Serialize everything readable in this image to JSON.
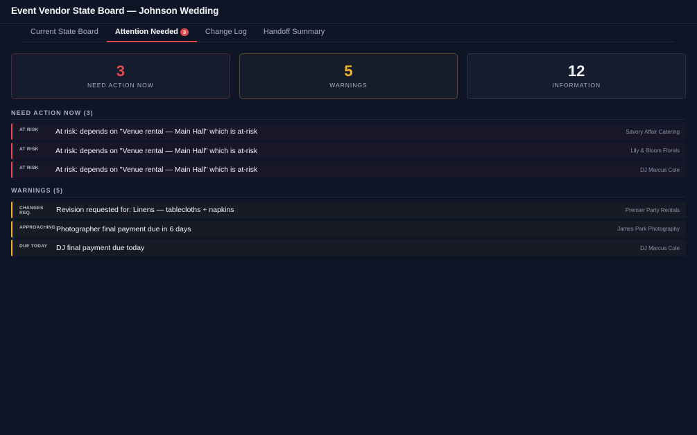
{
  "header": {
    "title": "Event Vendor State Board — Johnson Wedding"
  },
  "tabs": [
    {
      "label": "Current State Board",
      "active": false
    },
    {
      "label": "Attention Needed",
      "active": true,
      "badge": "3"
    },
    {
      "label": "Change Log",
      "active": false
    },
    {
      "label": "Handoff Summary",
      "active": false
    }
  ],
  "stats": [
    {
      "value": "3",
      "label": "NEED ACTION NOW",
      "color": "#e5484d"
    },
    {
      "value": "5",
      "label": "WARNINGS",
      "color": "#f0b429"
    },
    {
      "value": "12",
      "label": "INFORMATION",
      "color": "#f2f4f8"
    }
  ],
  "need_action": {
    "heading": "NEED ACTION NOW (3)",
    "items": [
      {
        "tag": "AT RISK",
        "text": "At risk: depends on \"Venue rental — Main Hall\" which is at-risk",
        "vendor": "Savory Affair Catering"
      },
      {
        "tag": "AT RISK",
        "text": "At risk: depends on \"Venue rental — Main Hall\" which is at-risk",
        "vendor": "Lily & Bloom Florals"
      },
      {
        "tag": "AT RISK",
        "text": "At risk: depends on \"Venue rental — Main Hall\" which is at-risk",
        "vendor": "DJ Marcus Cole"
      }
    ]
  },
  "warnings": {
    "heading": "WARNINGS (5)",
    "items": [
      {
        "tag": "CHANGES REQ.",
        "text": "Revision requested for: Linens — tablecloths + napkins",
        "vendor": "Premier Party Rentals"
      },
      {
        "tag": "APPROACHING",
        "text": "Photographer final payment due in 6 days",
        "vendor": "James Park Photography"
      },
      {
        "tag": "DUE TODAY",
        "text": "DJ final payment due today",
        "vendor": "DJ Marcus Cole"
      }
    ]
  },
  "colors": {
    "danger": "#e5484d",
    "warning": "#f0b429",
    "background": "#0e1526"
  }
}
